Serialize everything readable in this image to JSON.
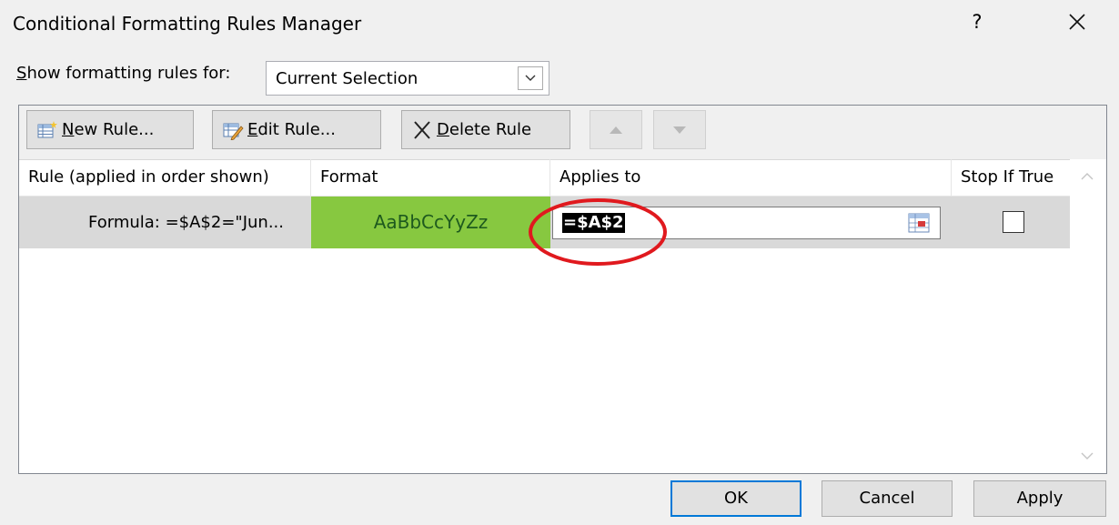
{
  "window": {
    "title": "Conditional Formatting Rules Manager",
    "help_label": "?"
  },
  "show_for": {
    "label_accel": "S",
    "label_rest": "how formatting rules for:",
    "value": "Current Selection"
  },
  "toolbar": {
    "new_rule": {
      "accel": "N",
      "rest": "ew Rule..."
    },
    "edit_rule": {
      "accel": "E",
      "rest": "dit Rule..."
    },
    "delete_rule": {
      "accel": "D",
      "rest": "elete Rule"
    }
  },
  "grid": {
    "headers": {
      "rule": "Rule (applied in order shown)",
      "format": "Format",
      "applies_to": "Applies to",
      "stop_if_true": "Stop If True"
    },
    "rows": [
      {
        "rule": "Formula: =$A$2=\"Jun...",
        "format_preview": "AaBbCcYyZz",
        "applies_to": "=$A$2",
        "stop_if_true": false
      }
    ]
  },
  "buttons": {
    "ok": "OK",
    "cancel": "Cancel",
    "apply": "Apply"
  },
  "colors": {
    "format_preview_bg": "#87c840",
    "highlight_ring": "#e0191e",
    "ok_border": "#0078d7"
  },
  "icons": [
    "close-icon",
    "chevron-down-icon",
    "new-rule-icon",
    "edit-rule-icon",
    "delete-x-icon",
    "arrow-up-icon",
    "arrow-down-icon",
    "range-select-icon",
    "scroll-up-icon",
    "scroll-down-icon"
  ]
}
